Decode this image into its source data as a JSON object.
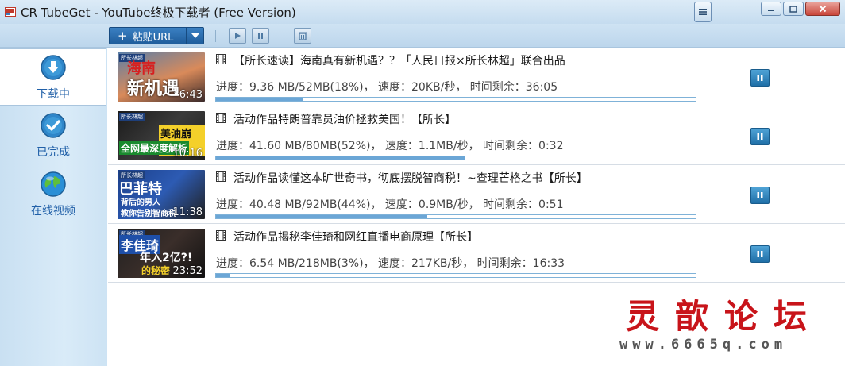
{
  "window": {
    "title": "CR TubeGet - YouTube终极下载者 (Free Version)"
  },
  "toolbar": {
    "paste_label": "粘贴URL",
    "paste_icon": "plus-icon"
  },
  "sidebar": {
    "items": [
      {
        "label": "下载中",
        "icon": "download-icon",
        "active": true
      },
      {
        "label": "已完成",
        "icon": "checkmark-icon",
        "active": false
      },
      {
        "label": "在线视频",
        "icon": "globe-icon",
        "active": false
      }
    ]
  },
  "downloads": [
    {
      "title": "【所长速读】海南真有新机遇？？「人民日报×所长林超」联合出品",
      "stats": "进度：9.36 MB/52MB(18%)， 速度：20KB/秒， 时间剩余：36:05",
      "progress": 0.18,
      "duration": "6:43",
      "thumb_badge": "所长林超",
      "thumb_text": [
        "海南",
        "新机遇"
      ]
    },
    {
      "title": "活动作品特朗普靠员油价拯救美国！【所长】",
      "stats": "进度：41.60 MB/80MB(52%)， 速度：1.1MB/秒， 时间剩余：0:32",
      "progress": 0.52,
      "duration": "10:16",
      "thumb_badge": "所长林超",
      "thumb_text": [
        "美油崩盘!",
        "全网最深度解析"
      ]
    },
    {
      "title": "活动作品读懂这本旷世奇书，彻底摆脱智商税！~查理芒格之书【所长】",
      "stats": "进度：40.48 MB/92MB(44%)， 速度：0.9MB/秒， 时间剩余：0:51",
      "progress": 0.44,
      "duration": "11:38",
      "thumb_badge": "所长林超",
      "thumb_text": [
        "巴菲特",
        "背后的男人",
        "教你告别智商税"
      ]
    },
    {
      "title": "活动作品揭秘李佳琦和网红直播电商原理【所长】",
      "stats": "进度：6.54 MB/218MB(3%)， 速度：217KB/秒， 时间剩余：16:33",
      "progress": 0.03,
      "duration": "23:52",
      "thumb_badge": "所长林超",
      "thumb_text": [
        "李佳琦",
        "年入2亿?!",
        "的秘密"
      ]
    }
  ],
  "watermark": {
    "main": "灵歆论坛",
    "url": "www.6665q.com"
  },
  "colors": {
    "accent": "#2160a8",
    "progress": "#6ba6d6",
    "watermark": "#c8141a"
  }
}
